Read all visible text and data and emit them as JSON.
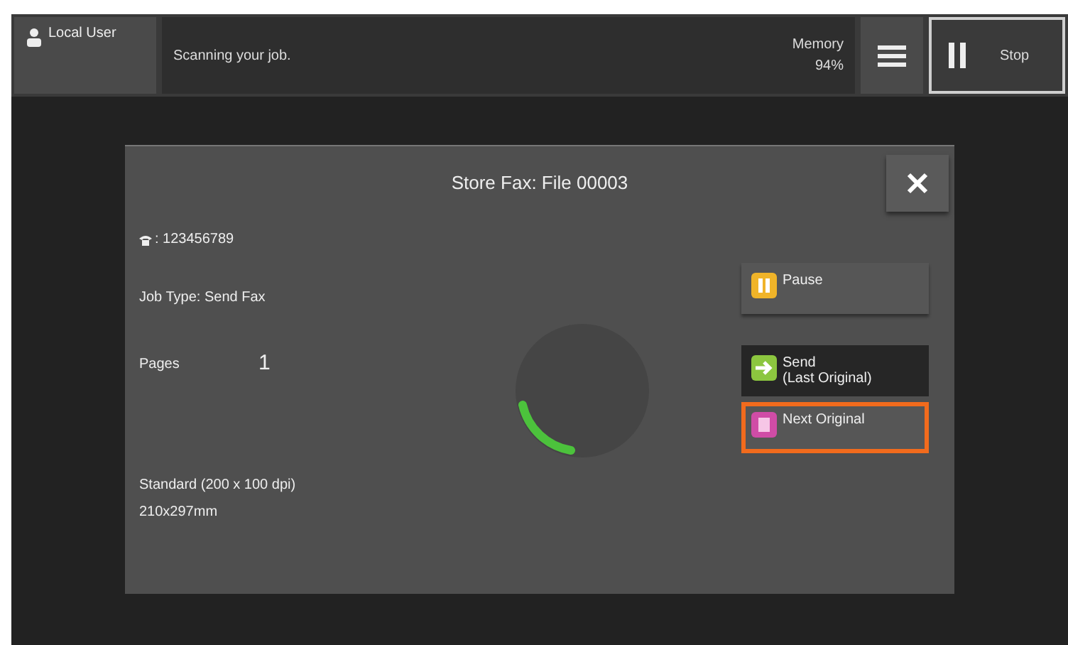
{
  "header": {
    "user": "Local User",
    "status": "Scanning your job.",
    "memory_label": "Memory",
    "memory_value": "94%",
    "stop": "Stop"
  },
  "dialog": {
    "title": "Store Fax: File 00003",
    "fax_number": ": 123456789",
    "job_type": "Job Type: Send Fax",
    "pages_label": "Pages",
    "pages_value": "1",
    "resolution": "Standard (200 x 100 dpi)",
    "size": "210x297mm",
    "buttons": [
      {
        "kind": "pause",
        "label": "Pause",
        "highlighted": false
      },
      {
        "kind": "send",
        "label": "Send\n(Last Original)",
        "highlighted": false
      },
      {
        "kind": "next",
        "label": "Next Original",
        "highlighted": true
      }
    ]
  }
}
